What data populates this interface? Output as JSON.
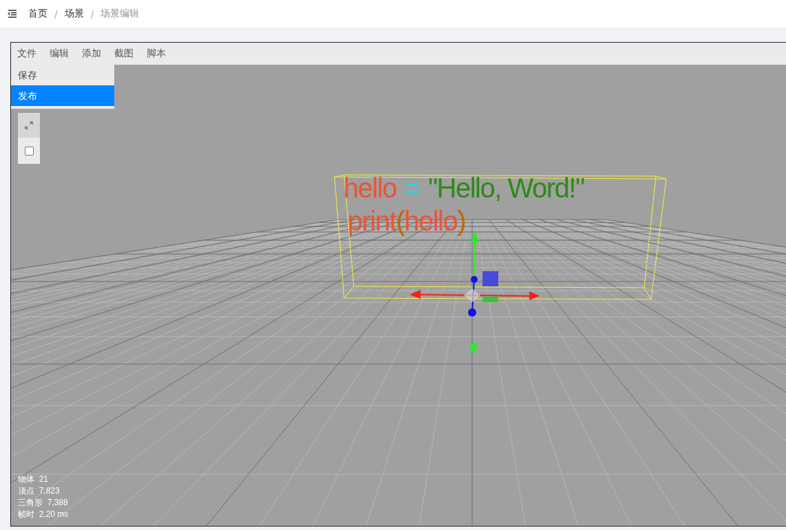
{
  "breadcrumb": [
    {
      "label": "首页",
      "current": false
    },
    {
      "label": "场景",
      "current": false
    },
    {
      "label": "场景编辑",
      "current": true
    }
  ],
  "breadcrumb_separators": [
    "/",
    "/"
  ],
  "menu_bar": [
    "文件",
    "编辑",
    "添加",
    "截图",
    "脚本"
  ],
  "file_menu": [
    {
      "label": "保存",
      "selected": false
    },
    {
      "label": "发布",
      "selected": true
    }
  ],
  "viewport_tools": {
    "checkbox": {
      "checked": false
    }
  },
  "scene_text": [
    {
      "segments": [
        {
          "text": "hello",
          "color": "#e8553a"
        },
        {
          "text": "=",
          "color": "#22d8e6"
        },
        {
          "text": "\"Hello, Word!\"",
          "color": "#2e8a18"
        }
      ]
    },
    {
      "segments": [
        {
          "text": "print",
          "color": "#e8553a"
        },
        {
          "text": "(",
          "color": "#b86a00"
        },
        {
          "text": "hello",
          "color": "#e8553a"
        },
        {
          "text": ")",
          "color": "#b86a00"
        }
      ]
    }
  ],
  "stats": [
    "物体  21",
    "顶点  7,823",
    "三角形  7,388",
    "帧时  2.20 ms"
  ]
}
